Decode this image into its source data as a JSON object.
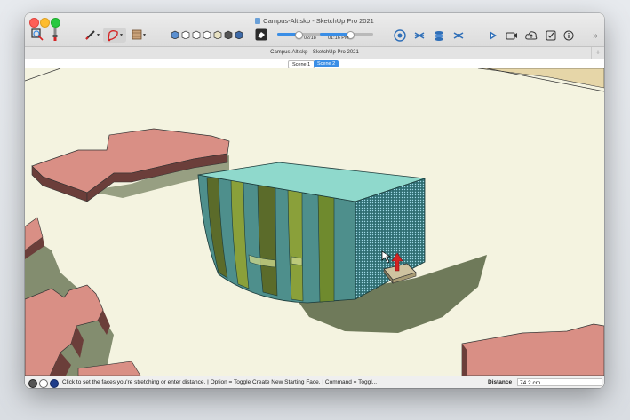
{
  "window": {
    "title": "Campus-Alt.skp - SketchUp Pro 2021",
    "document_title": "Campus-Alt.skp - SketchUp Pro 2021"
  },
  "toolbar": {
    "items": [
      {
        "icon": "search-icon"
      },
      {
        "icon": "paint-icon"
      },
      {
        "icon": "pencil-icon"
      },
      {
        "icon": "lasso-icon"
      },
      {
        "icon": "texture-icon"
      },
      {
        "icon": "styles-icon"
      },
      {
        "icon": "section-icon"
      },
      {
        "icon": "cloud-icon"
      },
      {
        "icon": "stack-icon"
      },
      {
        "icon": "settings-icon"
      },
      {
        "icon": "play-icon"
      },
      {
        "icon": "camera-icon"
      },
      {
        "icon": "upload-icon"
      },
      {
        "icon": "checkbox-icon"
      },
      {
        "icon": "info-icon"
      },
      {
        "icon": "overflow-icon"
      }
    ],
    "overflow": "»"
  },
  "timeline": {
    "date_label": "02/18",
    "time_label": "01:16 PM",
    "date_position": 0.33,
    "time_position": 0.56,
    "accent": "#3a8ee6"
  },
  "scenes": {
    "tabs": [
      {
        "label": "Scene 1",
        "active": false
      },
      {
        "label": "Scene 2",
        "active": true
      }
    ]
  },
  "status": {
    "message": "Click to set the faces you're stretching or enter distance. | Option = Toggle Create New Starting Face. | Command = Toggl...",
    "measure_label": "Distance",
    "measure_value": "74.2 cm"
  },
  "colors": {
    "ground": "#f4f3e0",
    "building_top": "#8fd9cc",
    "building_side": "#2e6e6e",
    "neighbor_buildings": "#d98f85",
    "shadow": "#6f7a5a",
    "cursor_arrow": "#d42323"
  }
}
